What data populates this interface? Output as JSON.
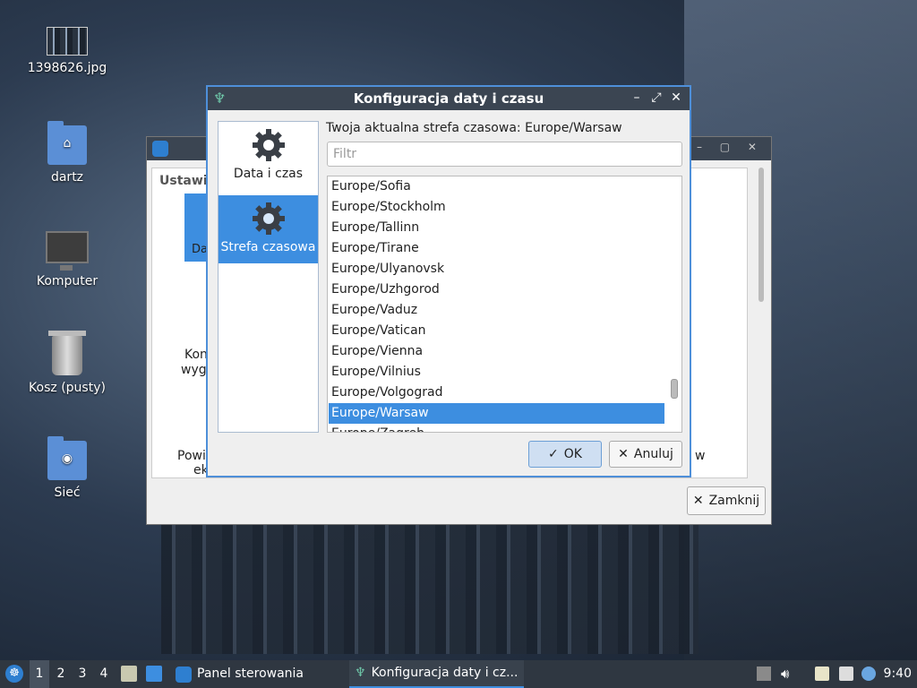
{
  "desktop": {
    "icons": [
      {
        "label": "1398626.jpg",
        "icon": "image-file-icon"
      },
      {
        "label": "dartz",
        "icon": "home-folder-icon"
      },
      {
        "label": "Komputer",
        "icon": "computer-icon"
      },
      {
        "label": "Kosz (pusty)",
        "icon": "trash-icon"
      },
      {
        "label": "Sieć",
        "icon": "network-folder-icon"
      }
    ]
  },
  "background_window": {
    "tab_label": "Ustawie",
    "tile_label": "Da",
    "fragments": [
      "Kon",
      "wyg",
      "Powi",
      "ek",
      "w"
    ],
    "close_label": "Zamknij"
  },
  "dialog": {
    "title": "Konfiguracja daty i czasu",
    "sidebar": [
      {
        "label": "Data i czas",
        "icon": "gear-icon",
        "active": false
      },
      {
        "label": "Strefa czasowa",
        "icon": "gear-icon",
        "active": true
      }
    ],
    "current_tz_label": "Twoja aktualna strefa czasowa:  Europe/Warsaw",
    "filter_placeholder": "Filtr",
    "timezones": [
      "Europe/Sofia",
      "Europe/Stockholm",
      "Europe/Tallinn",
      "Europe/Tirane",
      "Europe/Ulyanovsk",
      "Europe/Uzhgorod",
      "Europe/Vaduz",
      "Europe/Vatican",
      "Europe/Vienna",
      "Europe/Vilnius",
      "Europe/Volgograd",
      "Europe/Warsaw",
      "Europe/Zagreb"
    ],
    "selected_timezone": "Europe/Warsaw",
    "ok_label": "OK",
    "cancel_label": "Anuluj"
  },
  "taskbar": {
    "workspaces": [
      "1",
      "2",
      "3",
      "4"
    ],
    "active_workspace": "1",
    "tasks": [
      {
        "label": "Panel sterowania",
        "icon": "control-panel-icon",
        "active": false
      },
      {
        "label": "Konfiguracja daty i cz...",
        "icon": "clock-config-icon",
        "active": true
      }
    ],
    "clock": "9:40"
  },
  "colors": {
    "accent": "#3d8ee0",
    "titlebar": "#3b4552",
    "taskbar": "#2f3741"
  }
}
